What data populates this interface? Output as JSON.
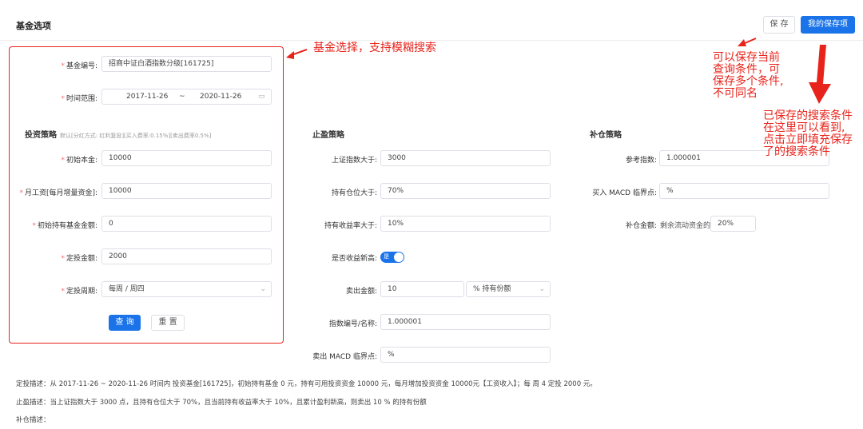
{
  "header": {
    "title": "基金选项",
    "save_label": "保 存",
    "my_saved_label": "我的保存项"
  },
  "fund": {
    "code_label": "基金编号:",
    "code_value": "招商中证白酒指数分级[161725]",
    "range_label": "时间范围:",
    "range_start": "2017-11-26",
    "range_sep": "~",
    "range_end": "2020-11-26"
  },
  "invest": {
    "title": "投资策略",
    "subtitle": "默认[分红方式: 红利复投][买入费率:0.15%][卖出费率0.5%]",
    "principal_label": "初始本金:",
    "principal_value": "10000",
    "salary_label": "月工资[每月增量资金]:",
    "salary_value": "10000",
    "init_fund_label": "初始持有基金金额:",
    "init_fund_value": "0",
    "fixed_amount_label": "定投金额:",
    "fixed_amount_value": "2000",
    "period_label": "定投周期:",
    "period_value": "每周 / 周四",
    "query_label": "查 询",
    "reset_label": "重 置"
  },
  "profit": {
    "title": "止盈策略",
    "index_label": "上证指数大于:",
    "index_value": "3000",
    "position_label": "持有仓位大于:",
    "position_value": "70%",
    "yield_label": "持有收益率大于:",
    "yield_value": "10%",
    "newhigh_label": "是否收益新高:",
    "newhigh_toggle_text": "是",
    "sell_label": "卖出金额:",
    "sell_value": "10",
    "sell_unit": "% 持有份额",
    "idx_name_label": "指数编号/名称:",
    "idx_name_value": "1.000001",
    "macd_label": "卖出 MACD 临界点:",
    "macd_value": "%"
  },
  "add": {
    "title": "补仓策略",
    "ref_label": "参考指数:",
    "ref_value": "1.000001",
    "buy_macd_label": "买入 MACD 临界点:",
    "buy_macd_value": "%",
    "amount_label": "补仓金额:",
    "amount_prefix": "剩余流动资金的",
    "amount_value": "20%"
  },
  "descriptions": {
    "fixed": "定投描述：从 2017-11-26 ~ 2020-11-26 时间内 投资基金[161725]，初始持有基金 0 元，持有可用投资资金 10000 元，每月增加投资资金 10000元【工资收入】；每 周 4 定投 2000 元。",
    "profit": "止盈描述：当上证指数大于 3000 点，且持有仓位大于 70%，且当前持有收益率大于 10%，且累计盈利新高，则卖出 10 % 的持有份额",
    "add": "补仓描述："
  },
  "annotations": {
    "fund_select": "基金选择，支持模糊搜索",
    "save_hint": "可以保存当前\n查询条件，可\n保存多个条件,\n不可同名",
    "saved_hint": "已保存的搜索条件\n在这里可以看到,\n点击立即填充保存\n了的搜索条件"
  },
  "colors": {
    "accent": "#1a73e8",
    "annotation": "#e8231b"
  }
}
